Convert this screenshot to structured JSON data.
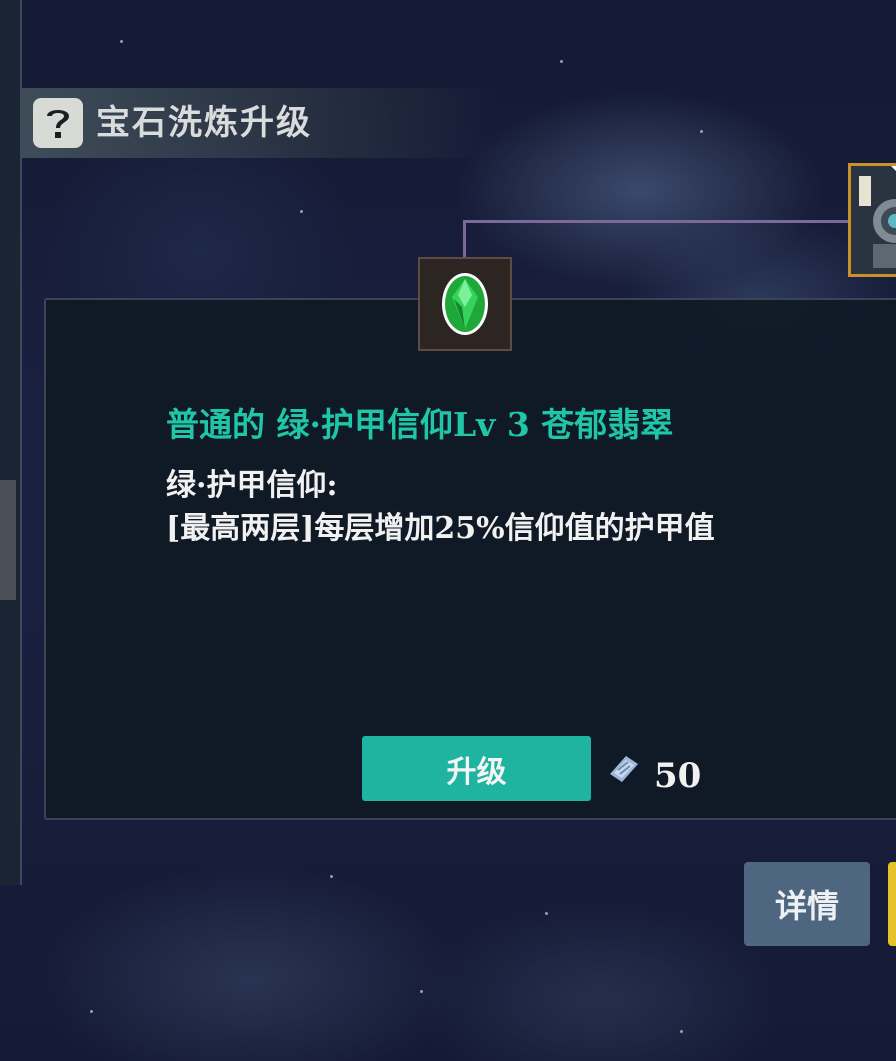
{
  "header": {
    "title": "宝石洗炼升级"
  },
  "gem": {
    "name": "普通的 绿·护甲信仰Lv 3 苍郁翡翠",
    "skill_name": "绿·护甲信仰:",
    "description": "[最高两层]每层增加25%信仰值的护甲值"
  },
  "actions": {
    "upgrade_label": "升级",
    "cost": "50",
    "detail_label": "详情"
  },
  "colors": {
    "gem_name": "#1fc7a8",
    "upgrade_button": "#1eb4a0",
    "detail_button": "#4f6680",
    "slot_border": "#c8912a",
    "yellow_button": "#e6c22a"
  },
  "icons": {
    "help": "question-icon",
    "gem": "green-gem-icon",
    "cost": "crystal-material-icon",
    "slot_item": "armor-item-icon"
  }
}
